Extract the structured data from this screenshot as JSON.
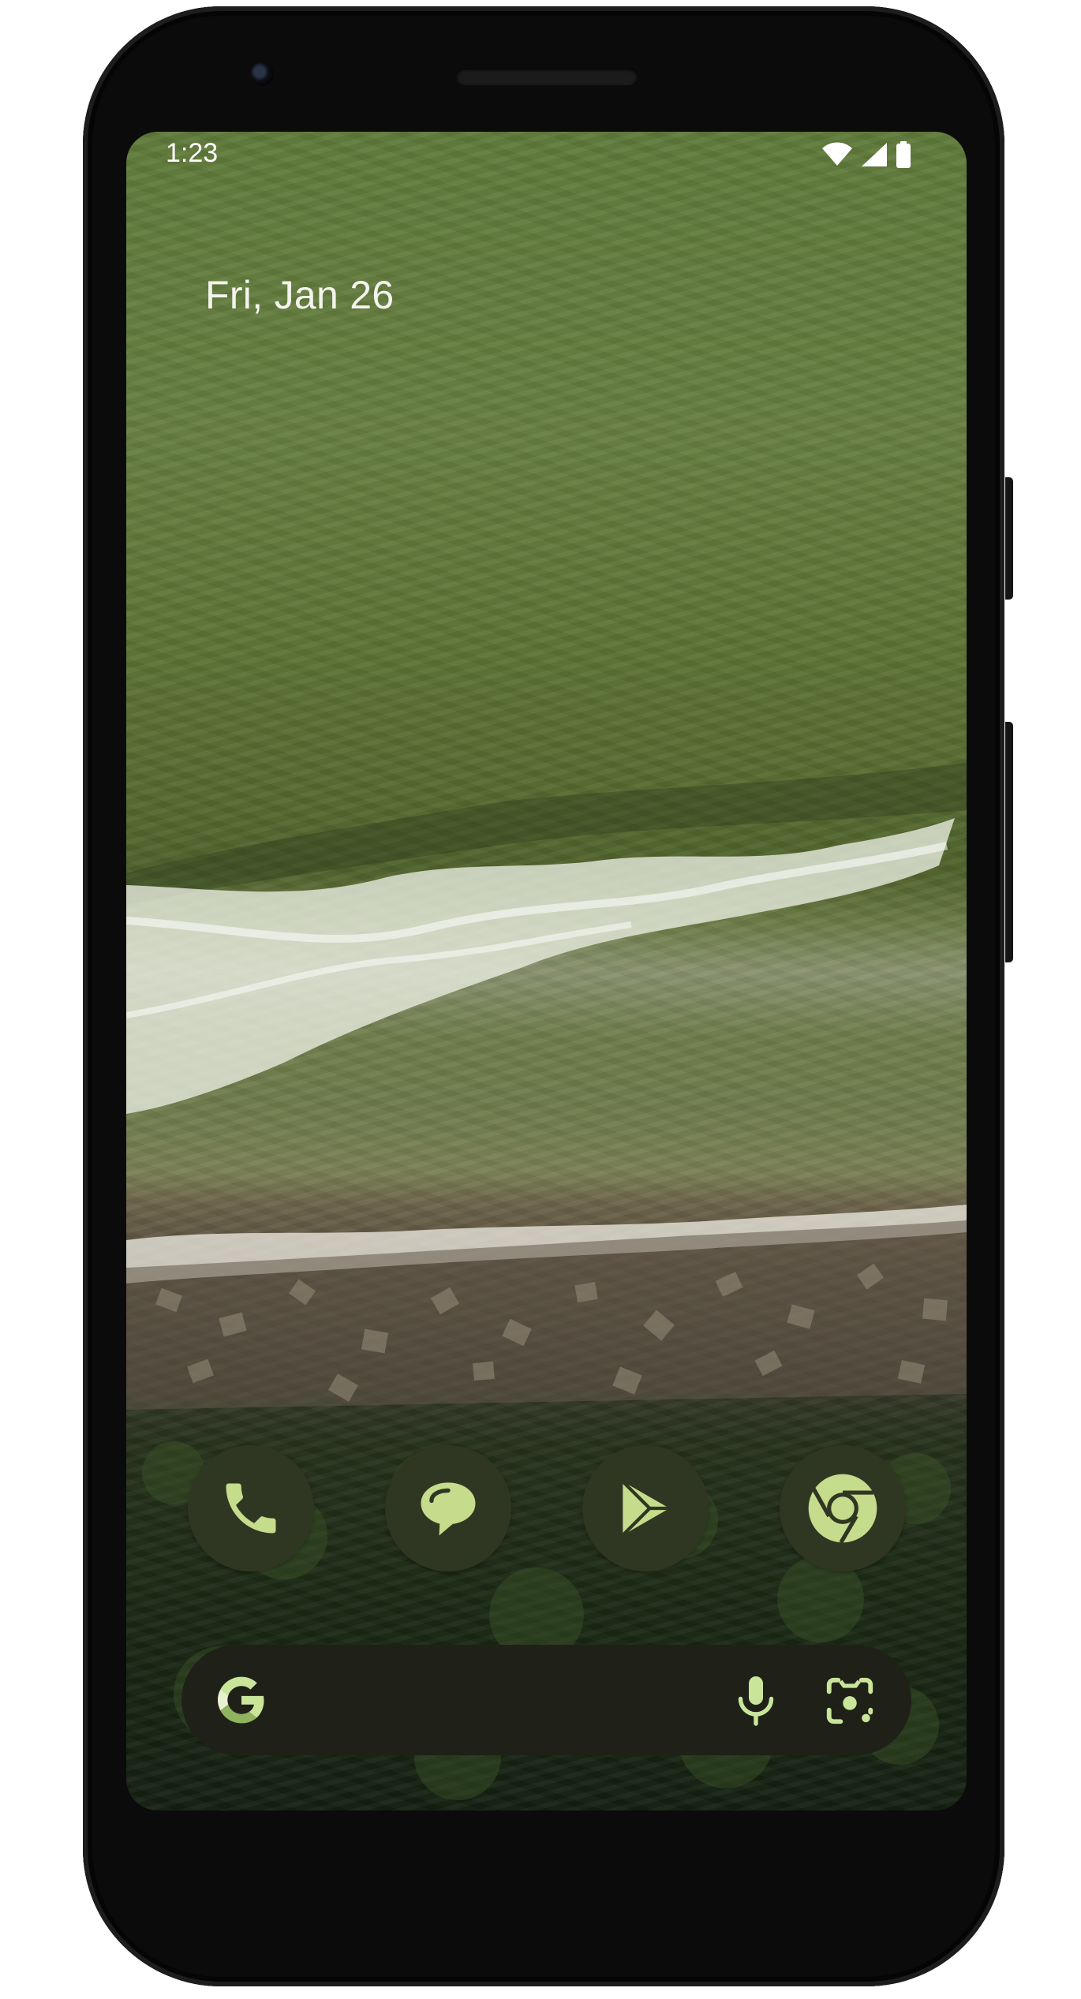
{
  "status_bar": {
    "time": "1:23",
    "icons": [
      "wifi-icon",
      "cell-signal-icon",
      "battery-icon"
    ]
  },
  "home": {
    "date": "Fri, Jan 26"
  },
  "dock": {
    "apps": [
      {
        "name": "phone-icon"
      },
      {
        "name": "messages-icon"
      },
      {
        "name": "play-store-icon"
      },
      {
        "name": "chrome-icon"
      }
    ]
  },
  "search": {
    "icons": [
      "google-g-icon",
      "microphone-icon",
      "google-lens-icon"
    ]
  },
  "colors": {
    "icon_bg": "#2f3723",
    "icon_fg": "#c4dc8c",
    "search_bg": "#1f2119",
    "accent": "#c9e59a"
  }
}
